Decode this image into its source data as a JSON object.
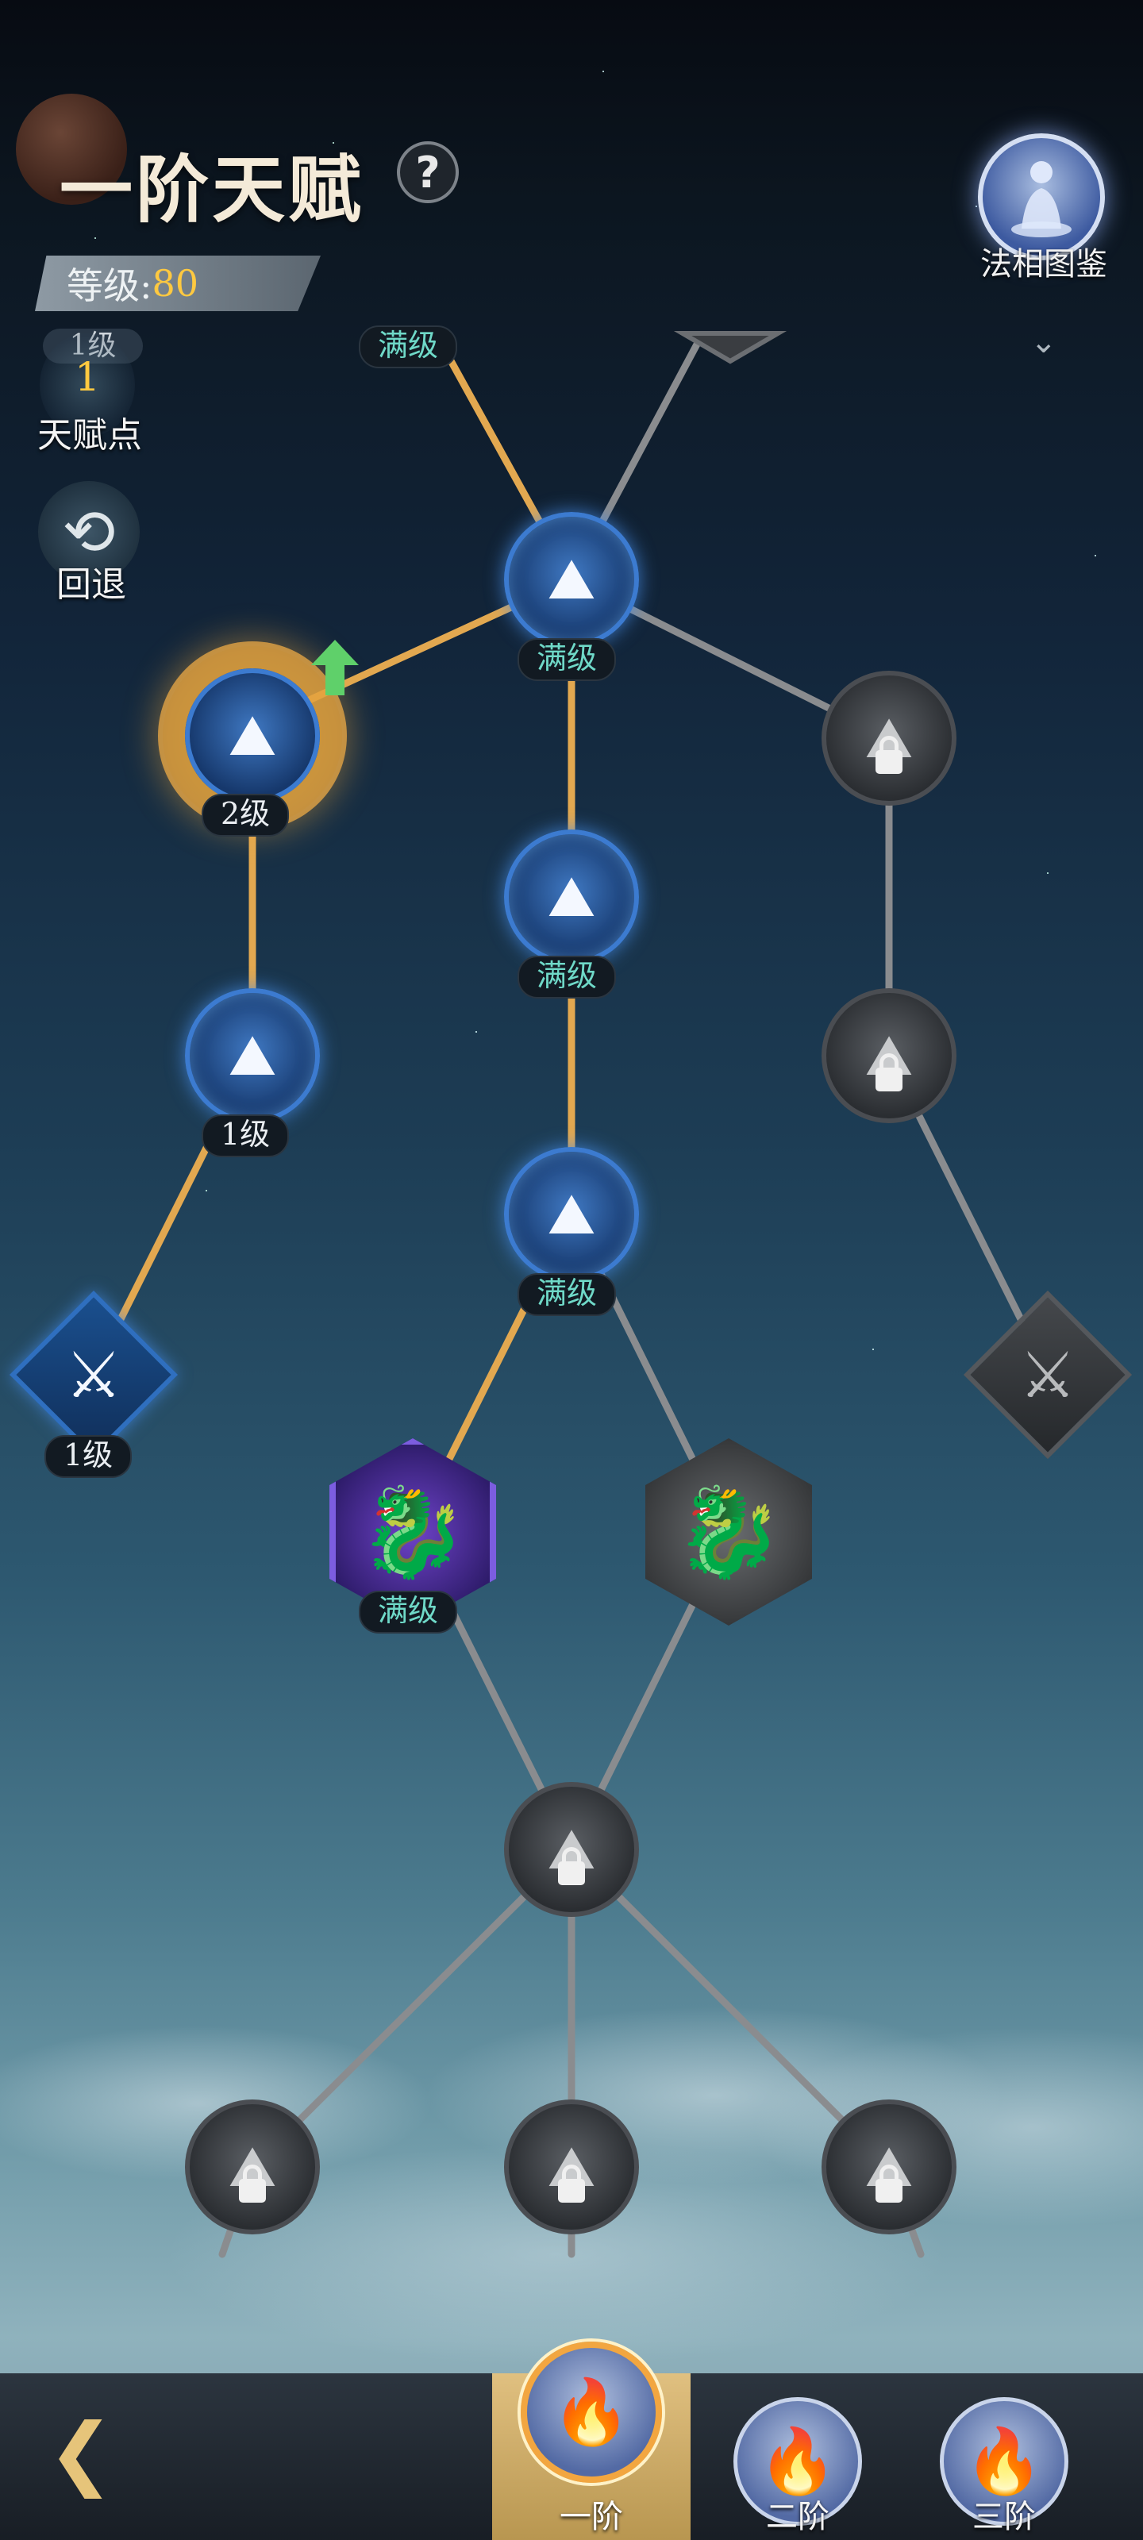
{
  "header": {
    "title": "一阶天赋",
    "help_icon": "?",
    "level_label": "等级:",
    "level_value": "80",
    "codex_label": "法相图鉴"
  },
  "side": {
    "talent_points_value": "1",
    "talent_points_label": "天赋点",
    "faded_level": "1级",
    "undo_label": "回退"
  },
  "tree": {
    "top_partial_badge": "满级",
    "nodes": {
      "n_top_center": "满级",
      "n_left_selected": "2级",
      "n_center_2": "满级",
      "n_left_2": "1级",
      "n_center_3": "满级",
      "n_left_diamond": "1级",
      "n_purple_hex": "满级"
    },
    "active_color": "#3c7bd0",
    "locked_color": "#4a4d52",
    "path_active_color": "#e2a850",
    "path_locked_color": "#8a8c8f"
  },
  "bottom": {
    "tabs": [
      {
        "label": "一阶",
        "selected": true
      },
      {
        "label": "二阶",
        "selected": false
      },
      {
        "label": "三阶",
        "selected": false
      }
    ]
  }
}
